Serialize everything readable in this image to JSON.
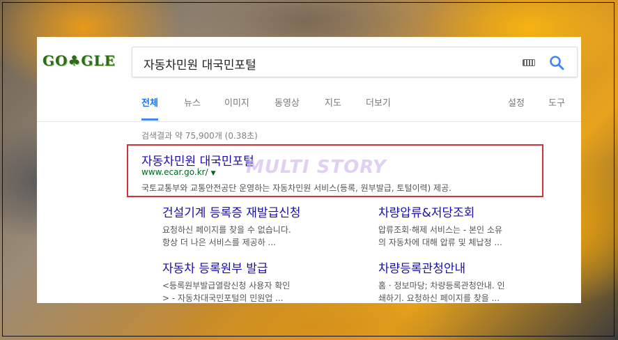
{
  "colors": {
    "link": "#1a0dab",
    "url": "#006621",
    "accent_blue": "#4285f4",
    "highlight_red": "#d0303a",
    "arrow": "#e55b2d"
  },
  "logo": {
    "text": "GO♣GLE"
  },
  "search": {
    "query": "자동차민원 대국민포털",
    "keyboard_icon": "keyboard-icon",
    "search_icon": "search-icon"
  },
  "tabs": [
    {
      "label": "전체",
      "active": true
    },
    {
      "label": "뉴스"
    },
    {
      "label": "이미지"
    },
    {
      "label": "동영상"
    },
    {
      "label": "지도"
    },
    {
      "label": "더보기"
    },
    {
      "label": "설정"
    },
    {
      "label": "도구"
    }
  ],
  "stats": {
    "text": "검색결과 약 75,900개 (0.38초)"
  },
  "result": {
    "title": "자동차민원 대국민포털",
    "url": "www.ecar.go.kr/",
    "caret": "▼",
    "description": "국토교통부와 교통안전공단 운영하는 자동차민원 서비스(등록, 원부발급, 토털이력) 제공."
  },
  "watermark": {
    "text": "MULTI STORY"
  },
  "sitelinks": [
    {
      "title": "건설기계 등록증 재발급신청",
      "desc1": "요청하신 페이지를 찾을 수 없습니다.",
      "desc2": "항상 더 나은 서비스를 제공하 ..."
    },
    {
      "title": "차량압류&저당조회",
      "desc1": "압류조회·해제 서비스는 - 본인 소유",
      "desc2": "의 자동차에 대해 압류 및 체납정 ..."
    },
    {
      "title": "자동차 등록원부 발급",
      "desc1": "<등록원부발급열람신청 사용자 확인",
      "desc2": "> - 자동차대국민포털의 민원업 ..."
    },
    {
      "title": "차량등록관청안내",
      "desc1": "홈 · 정보마당; 차량등록관청안내. 인",
      "desc2": "쇄하기. 요청하신 페이지를 찾을 ..."
    }
  ]
}
